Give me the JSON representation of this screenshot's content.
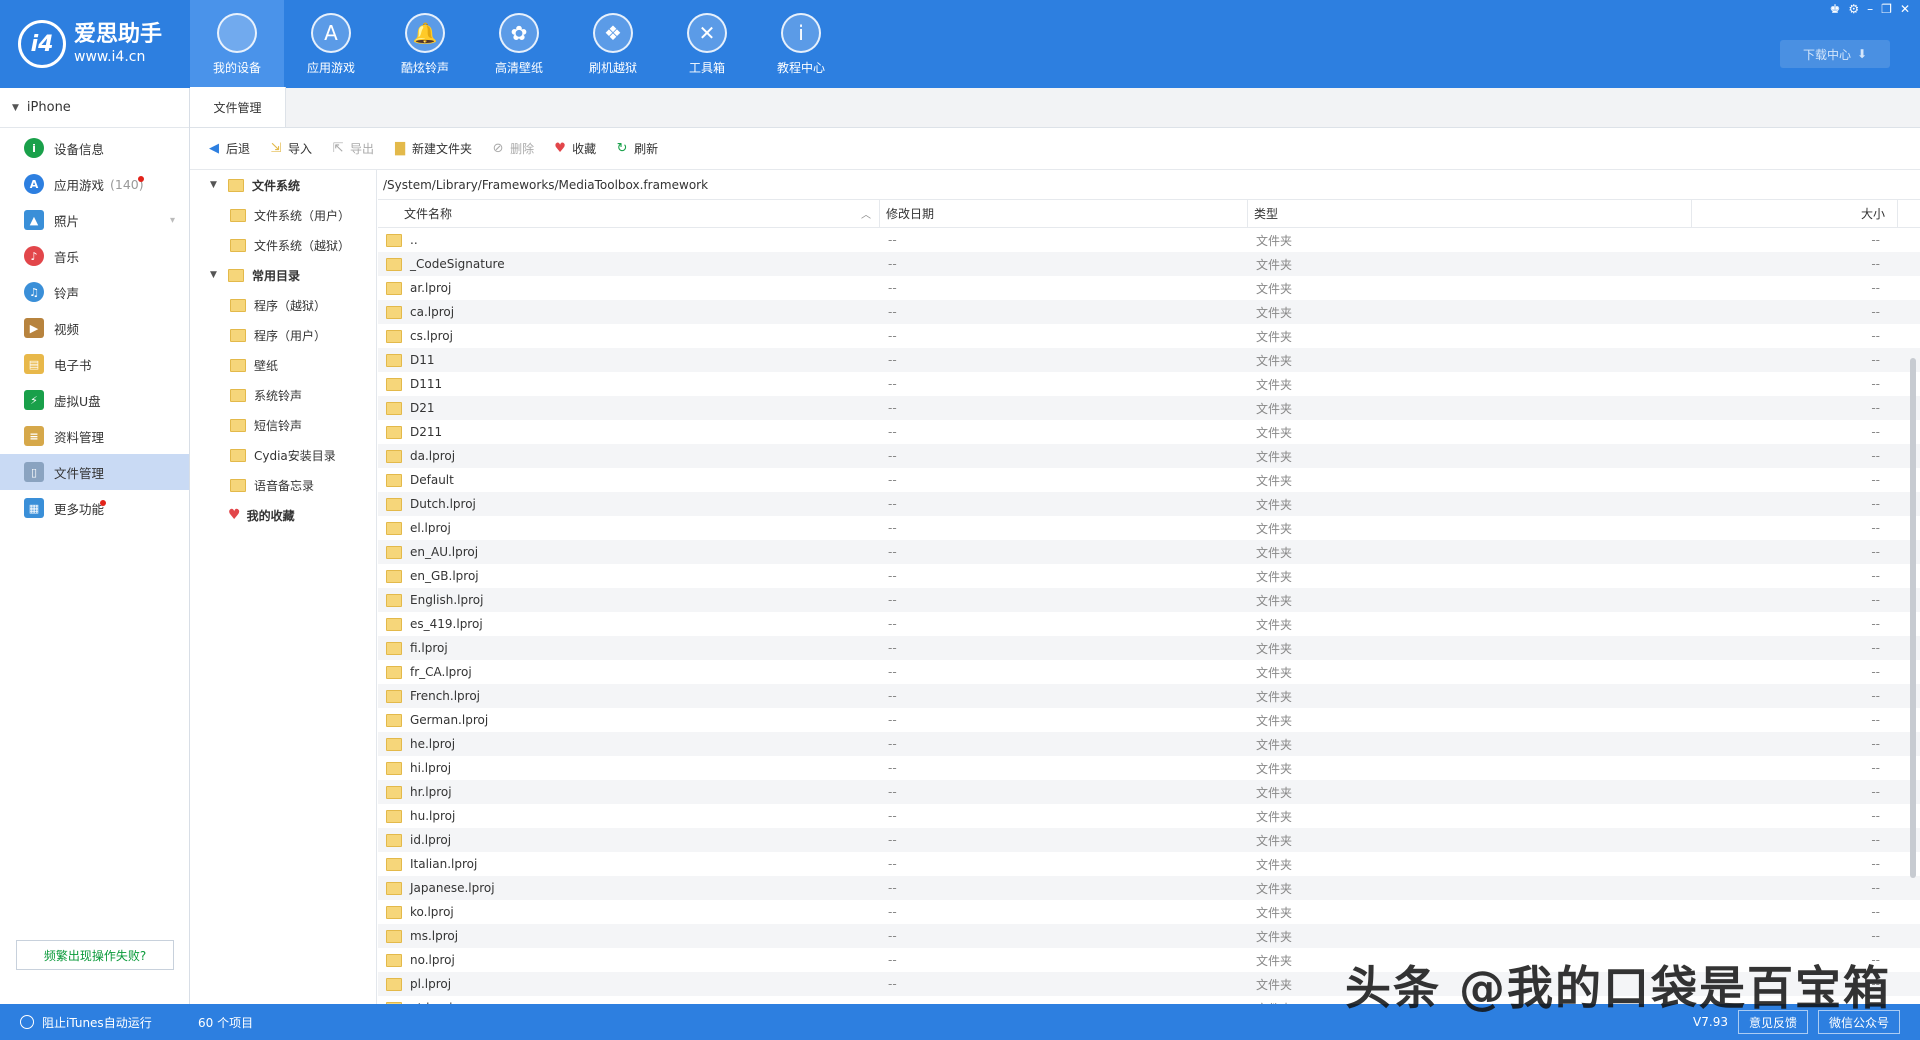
{
  "app": {
    "logo_badge": "i4",
    "logo_name": "爱思助手",
    "logo_url": "www.i4.cn",
    "accent": "#2d7fe0"
  },
  "nav": [
    {
      "label": "我的设备",
      "icon": "apple-icon"
    },
    {
      "label": "应用游戏",
      "icon": "appstore-icon"
    },
    {
      "label": "酷炫铃声",
      "icon": "bell-icon"
    },
    {
      "label": "高清壁纸",
      "icon": "flower-icon"
    },
    {
      "label": "刷机越狱",
      "icon": "dropbox-icon"
    },
    {
      "label": "工具箱",
      "icon": "tools-icon"
    },
    {
      "label": "教程中心",
      "icon": "info-icon"
    }
  ],
  "download_center": "下载中心",
  "sidebar": {
    "device": "iPhone",
    "items": [
      {
        "label": "设备信息",
        "icon": "info-circle-icon",
        "color": "#19a04a"
      },
      {
        "label": "应用游戏",
        "count": "(140)",
        "icon": "appstore-icon",
        "color": "#2d7fe0"
      },
      {
        "label": "照片",
        "icon": "photo-icon",
        "color": "#3a8fd8"
      },
      {
        "label": "音乐",
        "icon": "music-icon",
        "color": "#e2464a"
      },
      {
        "label": "铃声",
        "icon": "bell-icon",
        "color": "#3a8fd8"
      },
      {
        "label": "视频",
        "icon": "video-icon",
        "color": "#b7833e"
      },
      {
        "label": "电子书",
        "icon": "book-icon",
        "color": "#e8b84a"
      },
      {
        "label": "虚拟U盘",
        "icon": "usb-icon",
        "color": "#19a04a"
      },
      {
        "label": "资料管理",
        "icon": "document-icon",
        "color": "#d6a84a"
      },
      {
        "label": "文件管理",
        "icon": "file-icon",
        "color": "#8aa3c0"
      },
      {
        "label": "更多功能",
        "icon": "grid-icon",
        "color": "#3a8fd8"
      }
    ],
    "help_button": "频繁出现操作失败?"
  },
  "tab": "文件管理",
  "toolbar": {
    "back": "后退",
    "import": "导入",
    "export": "导出",
    "new_folder": "新建文件夹",
    "delete": "删除",
    "favorite": "收藏",
    "refresh": "刷新"
  },
  "tree": {
    "root1": "文件系统",
    "root1_children": [
      "文件系统（用户）",
      "文件系统（越狱）"
    ],
    "root2": "常用目录",
    "root2_children": [
      "程序（越狱）",
      "程序（用户）",
      "壁纸",
      "系统铃声",
      "短信铃声",
      "Cydia安装目录",
      "语音备忘录"
    ],
    "favorites": "我的收藏"
  },
  "path": "/System/Library/Frameworks/MediaToolbox.framework",
  "columns": {
    "name": "文件名称",
    "date": "修改日期",
    "type": "类型",
    "size": "大小"
  },
  "files": [
    "..",
    "_CodeSignature",
    "ar.lproj",
    "ca.lproj",
    "cs.lproj",
    "D11",
    "D111",
    "D21",
    "D211",
    "da.lproj",
    "Default",
    "Dutch.lproj",
    "el.lproj",
    "en_AU.lproj",
    "en_GB.lproj",
    "English.lproj",
    "es_419.lproj",
    "fi.lproj",
    "fr_CA.lproj",
    "French.lproj",
    "German.lproj",
    "he.lproj",
    "hi.lproj",
    "hr.lproj",
    "hu.lproj",
    "id.lproj",
    "Italian.lproj",
    "Japanese.lproj",
    "ko.lproj",
    "ms.lproj",
    "no.lproj",
    "pl.lproj",
    "pt.lproj"
  ],
  "file_date": "--",
  "file_type": "文件夹",
  "file_size": "--",
  "status": {
    "itunes": "阻止iTunes自动运行",
    "count": "60 个项目",
    "version": "V7.93",
    "feedback": "意见反馈",
    "wechat": "微信公众号"
  },
  "watermark": "头条 @我的口袋是百宝箱"
}
